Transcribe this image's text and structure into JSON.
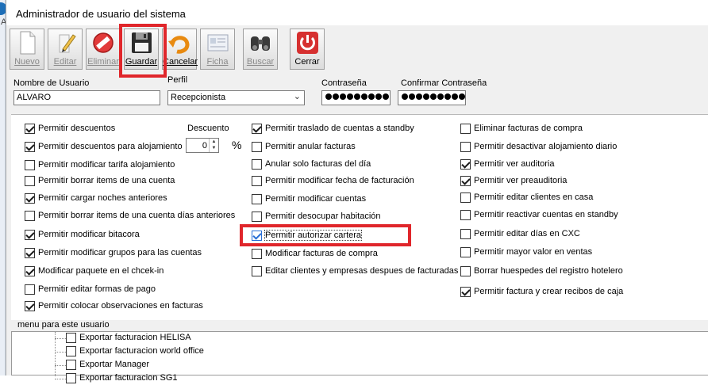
{
  "window": {
    "title": "Administrador de usuario del sistema"
  },
  "toolbar": {
    "buttons": [
      {
        "key": "nuevo",
        "label": "Nuevo",
        "icon": "new-document-icon",
        "enabled": false
      },
      {
        "key": "editar",
        "label": "Editar",
        "icon": "pencil-icon",
        "enabled": false
      },
      {
        "key": "eliminar",
        "label": "Eliminar",
        "icon": "delete-icon",
        "enabled": false
      },
      {
        "key": "guardar",
        "label": "Guardar",
        "icon": "floppy-disk-icon",
        "enabled": true
      },
      {
        "key": "cancelar",
        "label": "Cancelar",
        "icon": "undo-arrow-icon",
        "enabled": true
      },
      {
        "key": "ficha",
        "label": "Ficha",
        "icon": "card-file-icon",
        "enabled": false
      },
      {
        "key": "buscar",
        "label": "Buscar",
        "icon": "binoculars-icon",
        "enabled": false
      },
      {
        "key": "cerrar",
        "label": "Cerrar",
        "icon": "power-icon",
        "enabled": true
      }
    ]
  },
  "form": {
    "username_label": "Nombre de Usuario",
    "username_value": "ALVARO",
    "profile_label": "Perfil",
    "profile_value": "Recepcionista",
    "password_label": "Contraseña",
    "password_dots": 9,
    "confirm_password_label": "Confirmar Contraseña",
    "confirm_password_dots": 9
  },
  "discount": {
    "label": "Descuento",
    "value": "0",
    "unit": "%"
  },
  "permissions": {
    "col1": [
      {
        "label": "Permitir descuentos",
        "checked": true
      },
      {
        "label": "Permitir descuentos para alojamiento",
        "checked": true
      },
      {
        "label": "Permitir modificar tarifa alojamiento",
        "checked": false
      },
      {
        "label": "Permitir borrar items de una cuenta",
        "checked": false
      },
      {
        "label": "Permitir cargar noches anteriores",
        "checked": true
      },
      {
        "label": "Permitir borrar items de una cuenta días anteriores",
        "checked": false
      },
      {
        "label": "Permitir modificar bitacora",
        "checked": true
      },
      {
        "label": "Permitir modificar grupos para las cuentas",
        "checked": true
      },
      {
        "label": "Modificar paquete en el chcek-in",
        "checked": true
      },
      {
        "label": "Permitir editar formas de pago",
        "checked": false
      },
      {
        "label": "Permitir colocar observaciones en facturas",
        "checked": true
      }
    ],
    "col2": [
      {
        "label": "Permitir traslado de cuentas a standby",
        "checked": true
      },
      {
        "label": "Permitir anular facturas",
        "checked": false
      },
      {
        "label": "Anular solo facturas del día",
        "checked": false
      },
      {
        "label": "Permitir modificar fecha de facturación",
        "checked": false
      },
      {
        "label": "Permitir modificar cuentas",
        "checked": false
      },
      {
        "label": "Permitir desocupar habitación",
        "checked": false
      },
      {
        "label": "Permitir autorizar cartera",
        "checked": true
      },
      {
        "label": "Modificar facturas de compra",
        "checked": false
      },
      {
        "label": "Editar clientes y empresas despues de facturadas",
        "checked": false
      }
    ],
    "col3": [
      {
        "label": "Eliminar facturas de compra",
        "checked": false
      },
      {
        "label": "Permitir desactivar alojamiento diario",
        "checked": false
      },
      {
        "label": "Permitir ver auditoria",
        "checked": true
      },
      {
        "label": "Permitir ver preauditoria",
        "checked": true
      },
      {
        "label": "Permitir editar clientes en casa",
        "checked": false
      },
      {
        "label": "Permitir reactivar cuentas en standby",
        "checked": false
      },
      {
        "label": "Permitir editar días en CXC",
        "checked": false
      },
      {
        "label": "Permitir mayor valor en ventas",
        "checked": false
      },
      {
        "label": "Borrar huespedes del registro hotelero",
        "checked": false
      },
      {
        "label": "Permitir factura y crear recibos de caja",
        "checked": true
      }
    ]
  },
  "menu_tree": {
    "group_label": "menu para este usuario",
    "items": [
      {
        "label": "Exportar facturacion HELISA",
        "checked": false
      },
      {
        "label": "Exportar facturacion world office",
        "checked": false
      },
      {
        "label": "Exportar Manager",
        "checked": false
      },
      {
        "label": "Exportar facturacion SG1",
        "checked": false
      }
    ]
  },
  "colors": {
    "highlight": "#e0262b",
    "background": "#f0f0f0",
    "panel": "#ffffff"
  }
}
